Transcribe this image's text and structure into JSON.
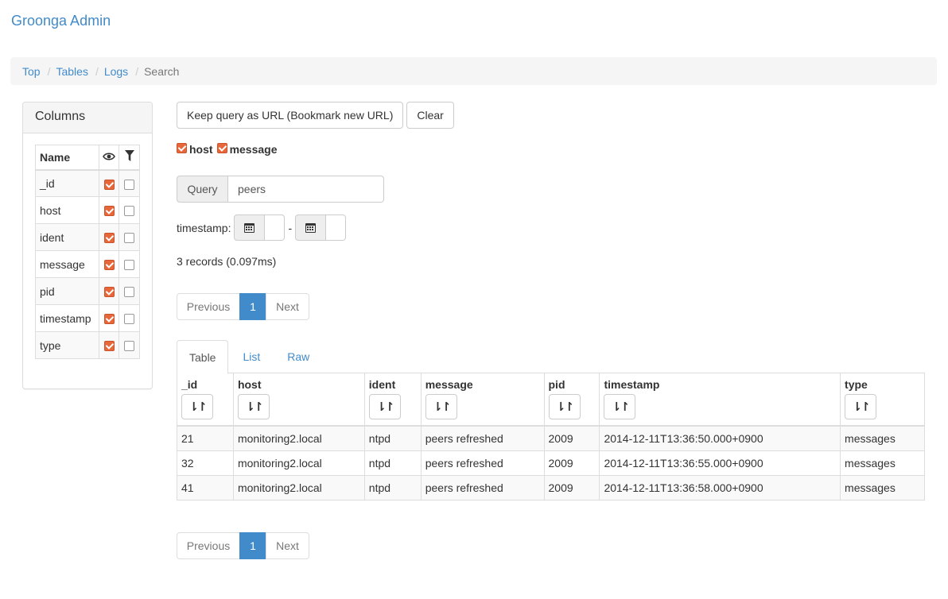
{
  "brand": "Groonga Admin",
  "breadcrumb": [
    {
      "label": "Top",
      "active": false
    },
    {
      "label": "Tables",
      "active": false
    },
    {
      "label": "Logs",
      "active": false
    },
    {
      "label": "Search",
      "active": true
    }
  ],
  "columns_panel": {
    "title": "Columns",
    "header": {
      "name": "Name",
      "visible_icon": "eye-icon",
      "filter_icon": "filter-icon"
    },
    "rows": [
      {
        "name": "_id",
        "visible": true,
        "filter": false
      },
      {
        "name": "host",
        "visible": true,
        "filter": false
      },
      {
        "name": "ident",
        "visible": true,
        "filter": false
      },
      {
        "name": "message",
        "visible": true,
        "filter": false
      },
      {
        "name": "pid",
        "visible": true,
        "filter": false
      },
      {
        "name": "timestamp",
        "visible": true,
        "filter": false
      },
      {
        "name": "type",
        "visible": true,
        "filter": false
      }
    ]
  },
  "toolbar": {
    "keep_query": "Keep query as URL (Bookmark new URL)",
    "clear": "Clear"
  },
  "match_columns": [
    "host",
    "message"
  ],
  "query": {
    "label": "Query",
    "value": "peers"
  },
  "timestamp_filter": {
    "label": "timestamp:",
    "separator": "-"
  },
  "record_count": "3 records (0.097ms)",
  "pagination": {
    "previous": "Previous",
    "current": "1",
    "next": "Next"
  },
  "tabs": [
    {
      "label": "Table",
      "active": true
    },
    {
      "label": "List",
      "active": false
    },
    {
      "label": "Raw",
      "active": false
    }
  ],
  "table": {
    "sort_icon": "sort-icon",
    "sort_glyph": "⇂↾",
    "columns": [
      "_id",
      "host",
      "ident",
      "message",
      "pid",
      "timestamp",
      "type"
    ],
    "rows": [
      [
        "21",
        "monitoring2.local",
        "ntpd",
        "peers refreshed",
        "2009",
        "2014-12-11T13:36:50.000+0900",
        "messages"
      ],
      [
        "32",
        "monitoring2.local",
        "ntpd",
        "peers refreshed",
        "2009",
        "2014-12-11T13:36:55.000+0900",
        "messages"
      ],
      [
        "41",
        "monitoring2.local",
        "ntpd",
        "peers refreshed",
        "2009",
        "2014-12-11T13:36:58.000+0900",
        "messages"
      ]
    ]
  },
  "colors": {
    "accent": "#428bca",
    "checkbox": "#e8673a"
  }
}
